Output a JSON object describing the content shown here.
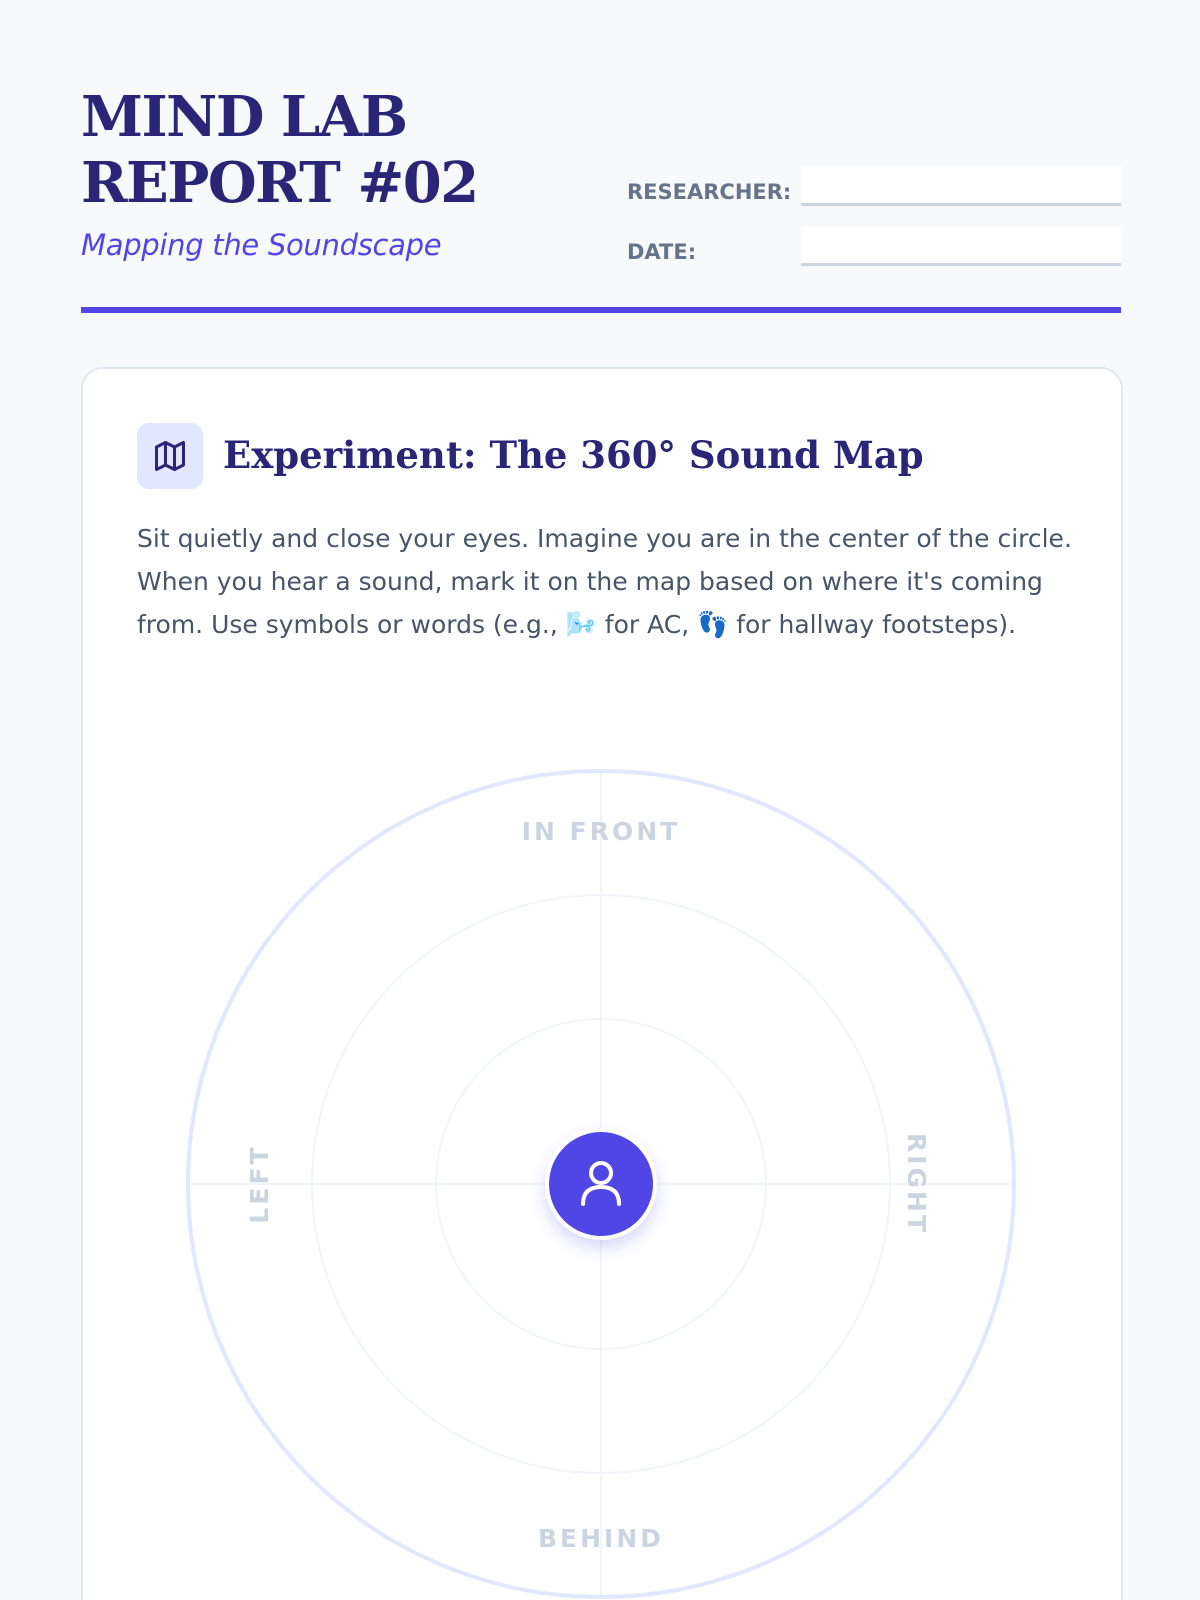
{
  "header": {
    "title": "MIND LAB REPORT #02",
    "subtitle": "Mapping the Soundscape",
    "researcher_label": "RESEARCHER:",
    "researcher_value": "",
    "date_label": "DATE:",
    "date_value": ""
  },
  "experiment": {
    "icon": "map-icon",
    "title": "Experiment: The 360° Sound Map",
    "instructions": "Sit quietly and close your eyes. Imagine you are in the center of the circle. When you hear a sound, mark it on the map based on where it's coming from. Use symbols or words (e.g., 🌬️ for AC, 👣 for hallway footsteps)."
  },
  "sound_map": {
    "directions": {
      "front": "IN FRONT",
      "behind": "BEHIND",
      "left": "LEFT",
      "right": "RIGHT"
    },
    "center_icon": "person-icon"
  },
  "colors": {
    "primary": "#4f46e5",
    "title": "#2a2577",
    "body_text": "#475569",
    "muted_label": "#cbd5e1",
    "icon_bg": "#e0e7ff"
  }
}
